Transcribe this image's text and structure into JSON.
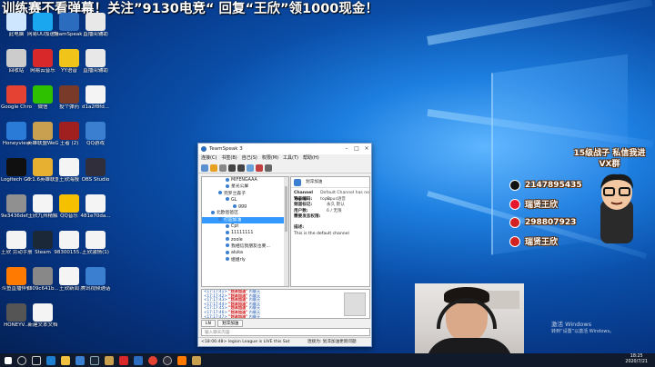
{
  "banner": {
    "text": "训练赛不看弹幕！关注”9130电竞“ 回复“王欣”领1000现金！"
  },
  "desktop_icons": [
    {
      "label": "此电脑",
      "color": "#cfe6ff"
    },
    {
      "label": "网易UU加速器",
      "color": "#1ba6f0"
    },
    {
      "label": "TeamSpeak 3",
      "color": "#2c6cbf"
    },
    {
      "label": "直播间辅助",
      "color": "#e8e8e8"
    },
    {
      "label": "回收站",
      "color": "#cccccc"
    },
    {
      "label": "网易云音乐",
      "color": "#d8282a"
    },
    {
      "label": "YY语音",
      "color": "#f0c419"
    },
    {
      "label": "直播间辅助",
      "color": "#e8e8e8"
    },
    {
      "label": "Google Chrome",
      "color": "#e54234"
    },
    {
      "label": "微信",
      "color": "#2dc100"
    },
    {
      "label": "投个弹药",
      "color": "#7a3a2a"
    },
    {
      "label": "d1a2f8fd...",
      "color": "#f4f4f4"
    },
    {
      "label": "Honeyview",
      "color": "#2a7bd8"
    },
    {
      "label": "英雄联盟WeGame 2.0",
      "color": "#c8a050"
    },
    {
      "label": "王者 (2)",
      "color": "#a02020"
    },
    {
      "label": "QQ游戏",
      "color": "#3a7fd0"
    },
    {
      "label": "Logitech G HUB",
      "color": "#101010"
    },
    {
      "label": "6.1.6英雄联盟击杀输入...",
      "color": "#e8b030"
    },
    {
      "label": "王欣海报",
      "color": "#f4f4f4"
    },
    {
      "label": "OBS Studio",
      "color": "#302e3a"
    },
    {
      "label": "9e3436def...",
      "color": "#909090"
    },
    {
      "label": "王欣九州精解",
      "color": "#f4f4f4"
    },
    {
      "label": "QQ音乐",
      "color": "#f5c000"
    },
    {
      "label": "481e70da...",
      "color": "#f4f4f4"
    },
    {
      "label": "王欣 劳动手册-0611-0...",
      "color": "#f4f4f4"
    },
    {
      "label": "Steam",
      "color": "#1b2838"
    },
    {
      "label": "98300155...",
      "color": "#f4f4f4"
    },
    {
      "label": "王欣激情(1)",
      "color": "#f4f4f4"
    },
    {
      "label": "斗鱼直播伴侣",
      "color": "#ff7a00"
    },
    {
      "label": "f309c641b...",
      "color": "#888888"
    },
    {
      "label": "王欣新闻",
      "color": "#f4f4f4"
    },
    {
      "label": "腾讯视频通话",
      "color": "#3a7fd0"
    },
    {
      "label": "HONEYV...",
      "color": "#555555"
    },
    {
      "label": "新建文本文档",
      "color": "#f4f4f4"
    }
  ],
  "teamspeak": {
    "title": "TeamSpeak 3",
    "menu": [
      "连接(C)",
      "书签(B)",
      "自己(S)",
      "权限(M)",
      "工具(T)",
      "帮助(H)"
    ],
    "tree": [
      {
        "label": "MIFENGAAA",
        "indent": 3,
        "selected": false
      },
      {
        "label": "星光公屏",
        "indent": 3,
        "selected": false
      },
      {
        "label": "完罗兰森子",
        "indent": 2,
        "selected": false
      },
      {
        "label": "GL",
        "indent": 3,
        "selected": false
      },
      {
        "label": "ggg",
        "indent": 4,
        "selected": false
      },
      {
        "label": "北欧爸爸区",
        "indent": 1,
        "selected": false
      },
      {
        "label": "打迎加油",
        "indent": 2,
        "selected": true
      },
      {
        "label": "Cpt",
        "indent": 3,
        "selected": false
      },
      {
        "label": "11111111",
        "indent": 3,
        "selected": false
      },
      {
        "label": "zoole",
        "indent": 3,
        "selected": false
      },
      {
        "label": "我相信我朋友也要...",
        "indent": 3,
        "selected": false
      },
      {
        "label": "aluka",
        "indent": 3,
        "selected": false
      },
      {
        "label": "姐姐rly",
        "indent": 3,
        "selected": false
      }
    ],
    "info_header": "划淬加油",
    "info": [
      {
        "k": "Channel Topic:",
        "v": "Default Channel has no topic"
      },
      {
        "k": "语音编码:",
        "v": "Opus语音"
      },
      {
        "k": "频道标记:",
        "v": "永久 默认"
      },
      {
        "k": "用户数:",
        "v": "6 / 无限"
      },
      {
        "k": "需要发言权限:",
        "v": ""
      }
    ],
    "info_desc_label": "描述:",
    "info_desc": "This is the default channel",
    "chat": [
      {
        "time": "<17:17:41>",
        "name": "\"划淬加油\"",
        "text": "内聊天"
      },
      {
        "time": "<17:17:42>",
        "name": "\"划淬加油\"",
        "text": "内聊天"
      },
      {
        "time": "<17:17:43>",
        "name": "\"划淬加油\"",
        "text": "内聊天"
      },
      {
        "time": "<17:17:44>",
        "name": "\"划淬加油\"",
        "text": "内聊天"
      },
      {
        "time": "<17:17:45>",
        "name": "\"划淬加油\"",
        "text": "内聊天"
      },
      {
        "time": "<17:17:46>",
        "name": "\"划淬加油\"",
        "text": "内聊天"
      },
      {
        "time": "<17:17:47>",
        "name": "\"划淬加油\"",
        "text": "内聊天"
      }
    ],
    "tabs": [
      "LN",
      "划淬加油"
    ],
    "chat_placeholder": "输入聊天内容",
    "status": "<18:06:48> legion League is LIVE this Sat",
    "status_right": "连接为: 划淬加油更新问题"
  },
  "social": {
    "title": "15级战子 私信我进VX群",
    "rows": [
      {
        "text": "2147895435",
        "color": "#111111"
      },
      {
        "text": "瑞贤王欣",
        "color": "#e6162d"
      },
      {
        "text": "298807923",
        "color": "#d22222"
      },
      {
        "text": "瑞贤王欣",
        "color": "#d22222"
      }
    ]
  },
  "activate": {
    "line1": "激活 Windows",
    "line2": "转到“设置”以激活 Windows。"
  },
  "clock": {
    "time": "18:25",
    "date": "2020/7/21"
  }
}
